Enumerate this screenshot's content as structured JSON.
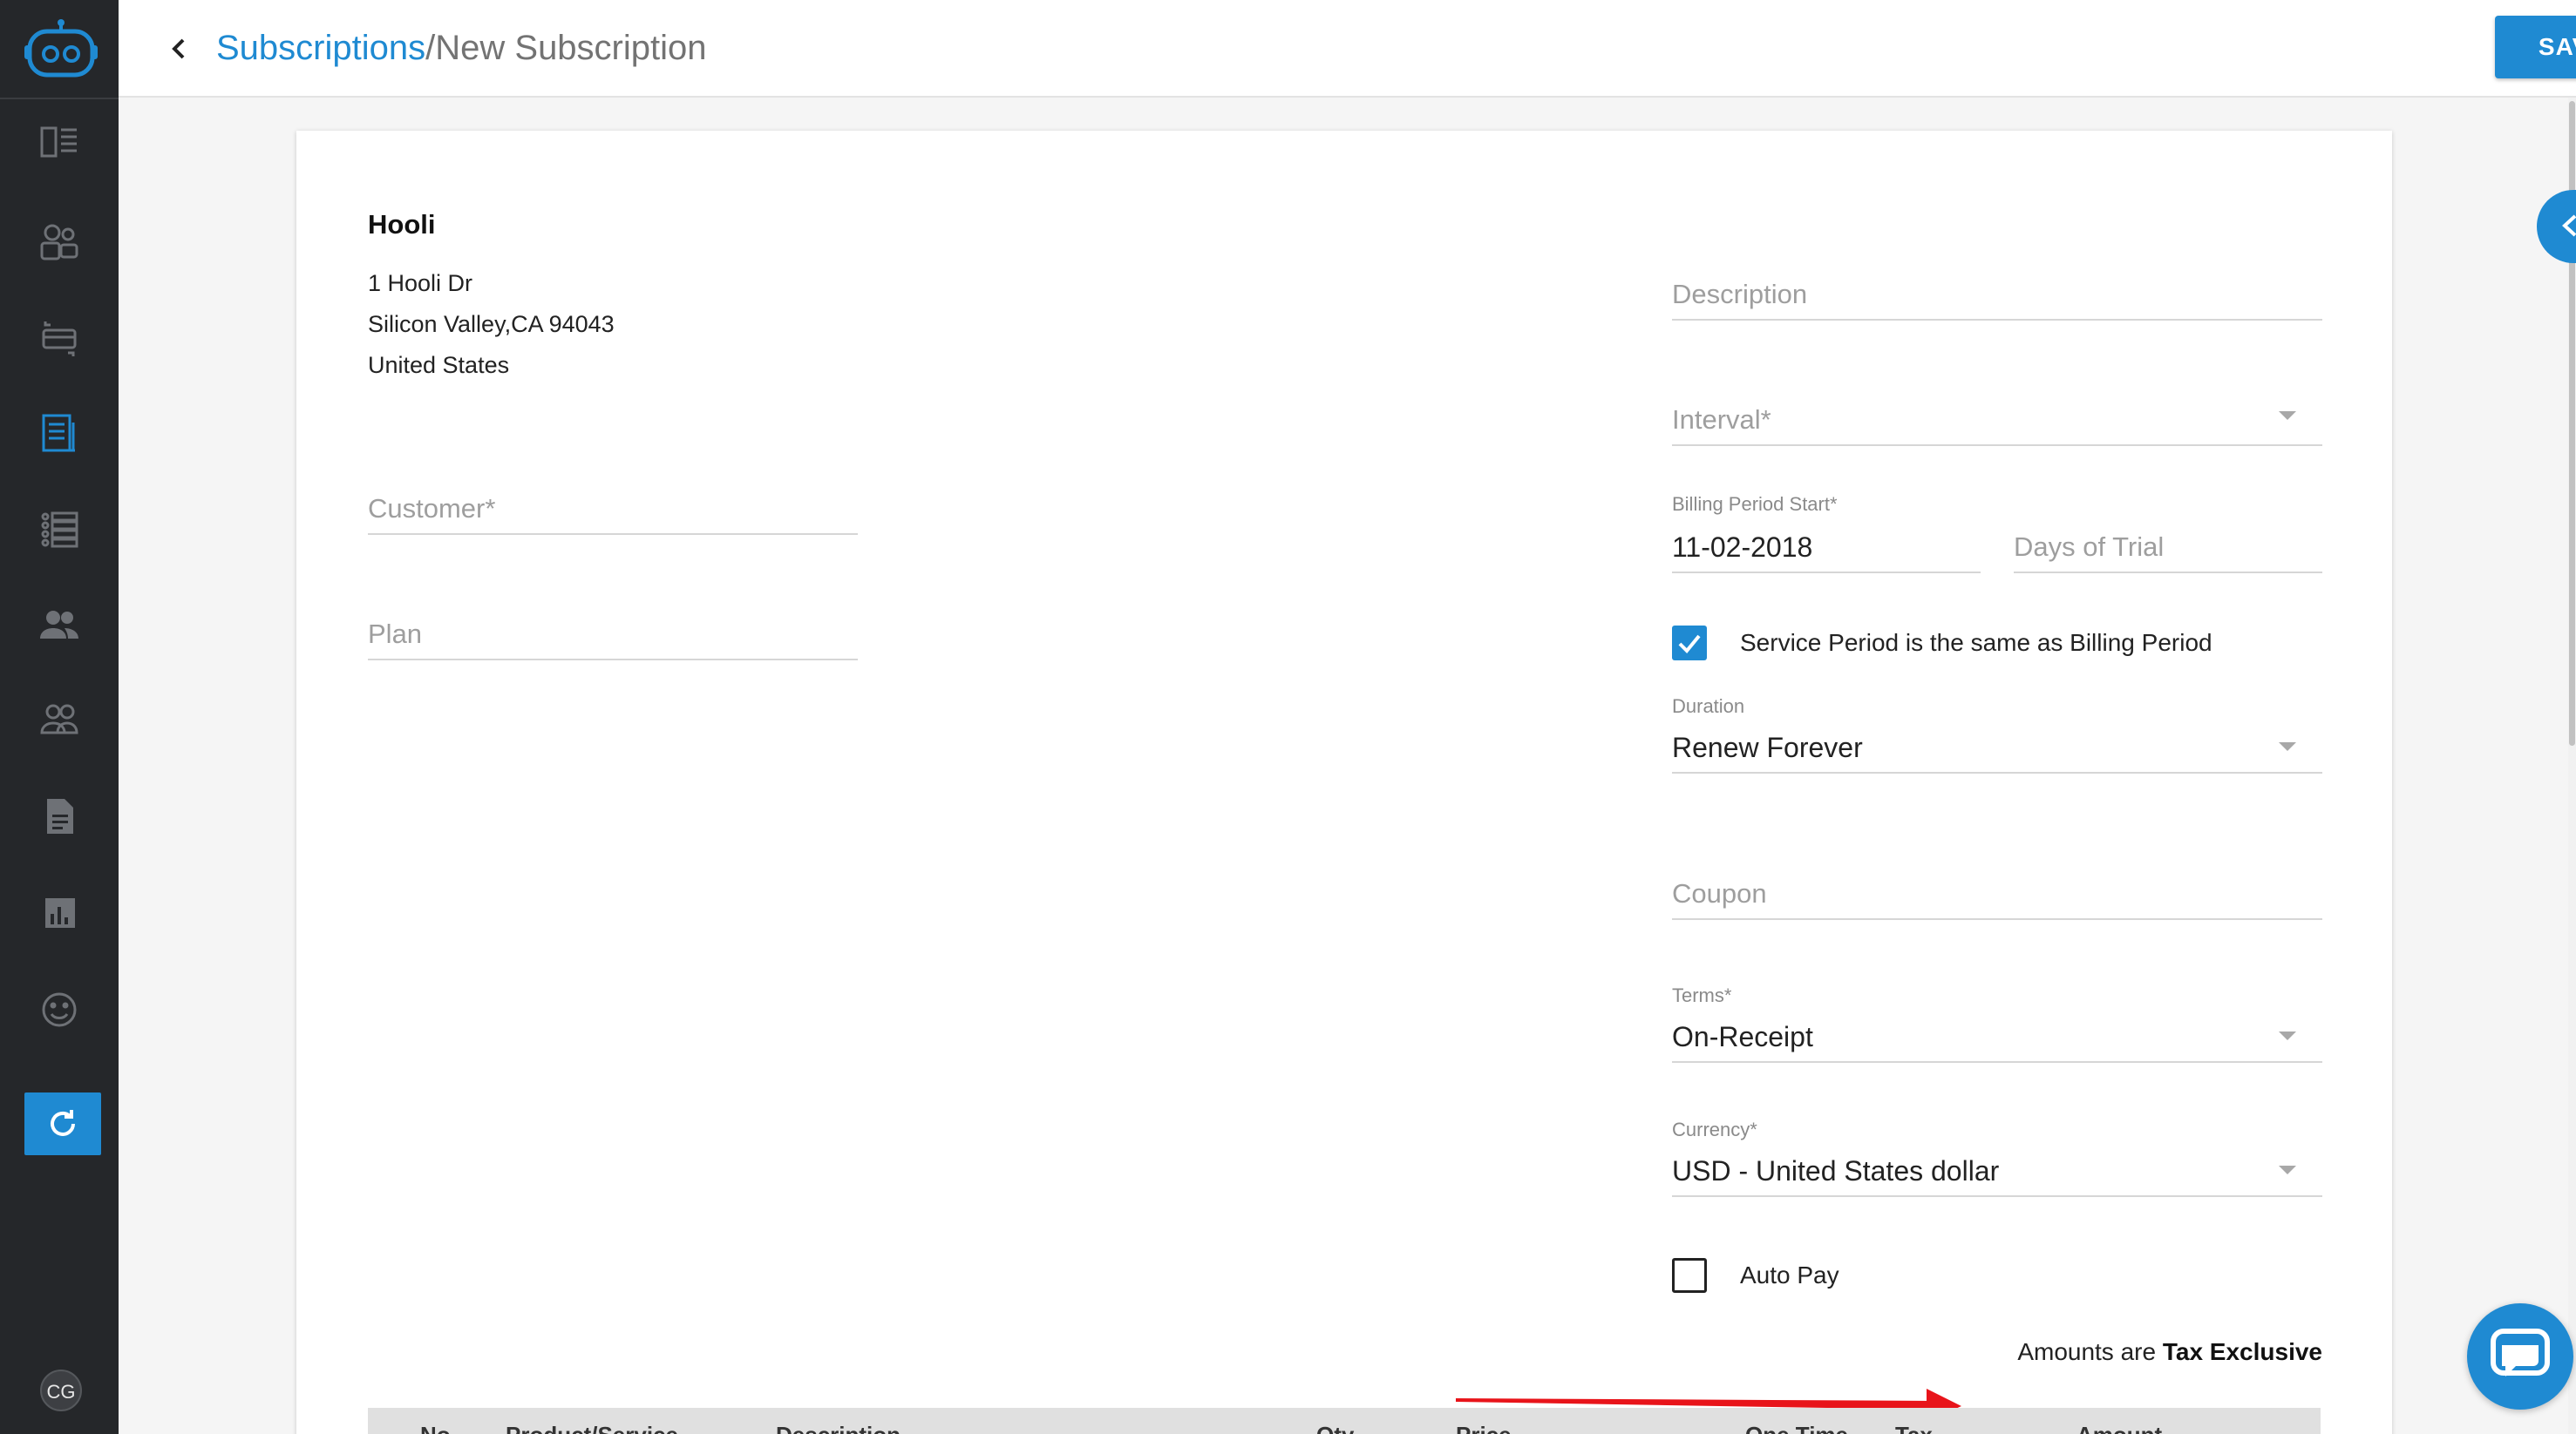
{
  "header": {
    "breadcrumb_link": "Subscriptions",
    "breadcrumb_sep": "/",
    "breadcrumb_current": "New Subscription",
    "save_label": "SAVE"
  },
  "sidebar": {
    "items": [
      {
        "icon": "dashboard-icon"
      },
      {
        "icon": "customers-icon"
      },
      {
        "icon": "payments-icon"
      },
      {
        "icon": "subscriptions-icon",
        "active": true
      },
      {
        "icon": "plans-list-icon"
      },
      {
        "icon": "contacts-icon"
      },
      {
        "icon": "team-icon"
      },
      {
        "icon": "documents-icon"
      },
      {
        "icon": "reports-icon"
      },
      {
        "icon": "feedback-icon"
      }
    ],
    "avatar_initials": "CG"
  },
  "company": {
    "name": "Hooli",
    "address_line1": "1 Hooli Dr",
    "address_line2": "Silicon Valley,CA 94043",
    "address_line3": "United States"
  },
  "form": {
    "customer_placeholder": "Customer*",
    "plan_placeholder": "Plan",
    "description_placeholder": "Description",
    "interval_placeholder": "Interval*",
    "billing_period_start_label": "Billing Period Start*",
    "billing_period_start_value": "11-02-2018",
    "days_of_trial_placeholder": "Days of Trial",
    "service_period_label": "Service Period is the same as Billing Period",
    "service_period_checked": true,
    "duration_label": "Duration",
    "duration_value": "Renew Forever",
    "coupon_placeholder": "Coupon",
    "terms_label": "Terms*",
    "terms_value": "On-Receipt",
    "currency_label": "Currency*",
    "currency_value": "USD - United States dollar",
    "auto_pay_label": "Auto Pay",
    "auto_pay_checked": false,
    "tax_note_prefix": "Amounts are",
    "tax_note_value": "Tax Exclusive"
  },
  "table": {
    "columns": [
      "No.",
      "Product/Service",
      "Description",
      "Qty",
      "Price",
      "One Time",
      "Tax",
      "Amount"
    ]
  },
  "colors": {
    "accent": "#1f8ad2",
    "sidebar_bg": "#25272a",
    "annotation_arrow": "#e8141a"
  }
}
